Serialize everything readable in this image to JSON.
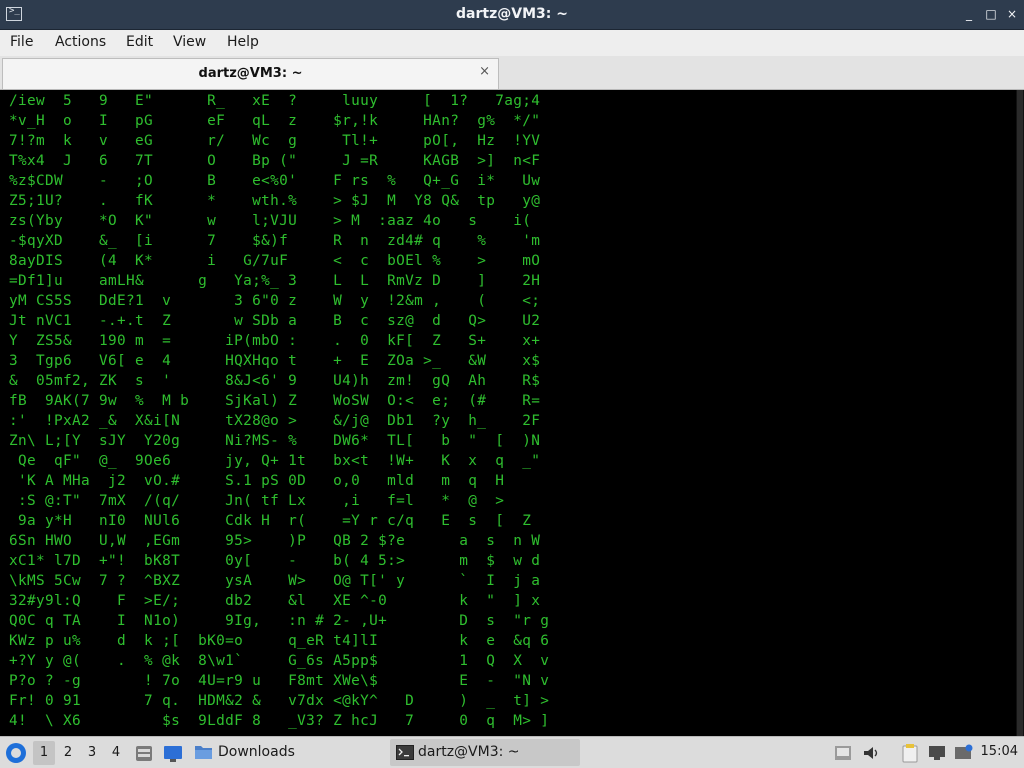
{
  "window": {
    "title": "dartz@VM3: ~",
    "app_icon": ">_",
    "controls": {
      "minimize": "_",
      "maximize": "□",
      "close": "×"
    }
  },
  "menu": [
    "File",
    "Actions",
    "Edit",
    "View",
    "Help"
  ],
  "tab": {
    "label": "dartz@VM3: ~",
    "close": "×"
  },
  "terminal": {
    "lines": [
      " /iew  5   9   E\"      R_   xE  ?     luuy     [  1?   7ag;4 ",
      " *v_H  o   I   pG      eF   qL  z    $r,!k     HAn?  g%  */\" ",
      " 7!?m  k   v   eG      r/   Wc  g     Tl!+     pO[,  Hz  !YV ",
      " T%x4  J   6   7T      O    Bp (\"     J =R     KAGB  >]  n<F ",
      " %z$CDW    -   ;O      B    e<%0'    F rs  %   Q+_G  i*   Uw ",
      " Z5;1U?    .   fK      *    wth.%    > $J  M  Y8 Q&  tp   y@ ",
      " zs(Yby    *O  K\"      w    l;VJU    > M  :aaz 4o   s    i( ",
      " -$qyXD    &_  [i      7    $&)f     R  n  zd4# q    %    'm ",
      " 8ayDIS    (4  K*      i   G/7uF     <  c  bOEl %    >    mO ",
      " =Df1]u    amLH&      g   Ya;%_ 3    L  L  RmVz D    ]    2H ",
      " yM CS5S   DdE?1  v       3 6\"0 z    W  y  !2&m ,    (    <; ",
      " Jt nVC1   -.+.t  Z       w SDb a    B  c  sz@  d   Q>    U2 ",
      " Y  ZS5&   190 m  =      iP(mbO :    .  0  kF[  Z   S+    x+ ",
      " 3  Tgp6   V6[ e  4      HQXHqo t    +  E  ZOa >_   &W    x$ ",
      " &  05mf2, ZK  s  '      8&J<6' 9    U4)h  zm!  gQ  Ah    R$ ",
      " fB  9AK(7 9w  %  M b    SjKal) Z    WoSW  O:<  e;  (#    R= ",
      " :'  !PxA2 _&  X&i[N     tX28@o >    &/j@  Db1  ?y  h_    2F ",
      " Zn\\ L;[Y  sJY  Y20g     Ni?MS- %    DW6*  TL[   b  \"  [  )N ",
      "  Qe  qF\"  @_  9Oe6      jy, Q+ 1t   bx<t  !W+   K  x  q  _\" ",
      "  'K A MHa  j2  vO.#     S.1 pS 0D   o,0   mld   m  q  H     ",
      "  :S @:T\"  7mX  /(q/     Jn( tf Lx    ,i   f=l   *  @  >     ",
      "  9a y*H   nI0  NUl6     Cdk H  r(    =Y r c/q   E  s  [  Z  ",
      " 6Sn HWO   U,W  ,EGm     95>    )P   QB 2 $?e      a  s  n W ",
      " xC1* l7D  +\"!  bK8T     0y[    -    b( 4 5:>      m  $  w d ",
      " \\kMS 5Cw  7 ?  ^BXZ     ysA    W>   O@ T[' y      `  I  j a ",
      " 32#y9l:Q    F  >E/;     db2    &l   XE ^-0        k  \"  ] x ",
      " Q0C q TA    I  N1o)     9Ig,   :n # 2- ,U+        D  s  \"r g ",
      " KWz p u%    d  k ;[  bK0=o     q_eR t4]lI         k  e  &q 6 ",
      " +?Y y @(    .  % @k  8\\w1`     G_6s A5pp$         1  Q  X  v ",
      " P?o ? -g       ! 7o  4U=r9 u   F8mt XWe\\$         E  -  \"N v ",
      " Fr! 0 91       7 q.  HDM&2 &   v7dx <@kY^   D     )  _  t] > ",
      " 4!  \\ X6         $s  9LddF 8   _V3? Z hcJ   7     0  q  M> ] "
    ]
  },
  "taskbar": {
    "workspaces": [
      "1",
      "2",
      "3",
      "4"
    ],
    "active_workspace": "1",
    "tasks": [
      {
        "label": "Downloads",
        "icon": "folder-icon"
      },
      {
        "label": "dartz@VM3: ~",
        "icon": "terminal-icon"
      }
    ],
    "clock": "15:04"
  }
}
